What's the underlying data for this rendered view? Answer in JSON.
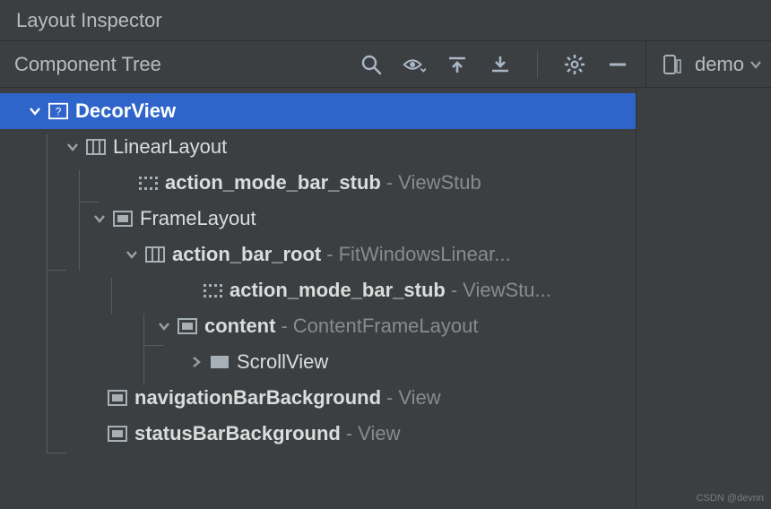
{
  "header": {
    "title": "Layout Inspector"
  },
  "toolbar": {
    "title": "Component Tree",
    "device": "demo"
  },
  "tree": {
    "rows": [
      {
        "indent": 28,
        "arrow": "down",
        "icon": "decor",
        "name": "DecorView",
        "type": "",
        "selected": true
      },
      {
        "indent": 70,
        "arrow": "down",
        "icon": "linear",
        "name": "LinearLayout",
        "type": "",
        "bold": false
      },
      {
        "indent": 128,
        "arrow": "none",
        "icon": "dots",
        "name": "action_mode_bar_stub",
        "type": "ViewStub"
      },
      {
        "indent": 100,
        "arrow": "down",
        "icon": "frame",
        "name": "FrameLayout",
        "type": "",
        "bold": false
      },
      {
        "indent": 136,
        "arrow": "down",
        "icon": "linear",
        "name": "action_bar_root",
        "type": "FitWindowsLinear..."
      },
      {
        "indent": 200,
        "arrow": "none",
        "icon": "dots",
        "name": "action_mode_bar_stub",
        "type": "ViewStu..."
      },
      {
        "indent": 172,
        "arrow": "down",
        "icon": "frame",
        "name": "content",
        "type": "ContentFrameLayout"
      },
      {
        "indent": 208,
        "arrow": "right",
        "icon": "solid",
        "name": "ScrollView",
        "type": "",
        "bold": false
      },
      {
        "indent": 94,
        "arrow": "none",
        "icon": "frame",
        "name": "navigationBarBackground",
        "type": "View"
      },
      {
        "indent": 94,
        "arrow": "none",
        "icon": "frame",
        "name": "statusBarBackground",
        "type": "View"
      }
    ]
  },
  "watermark": "CSDN @devnn"
}
